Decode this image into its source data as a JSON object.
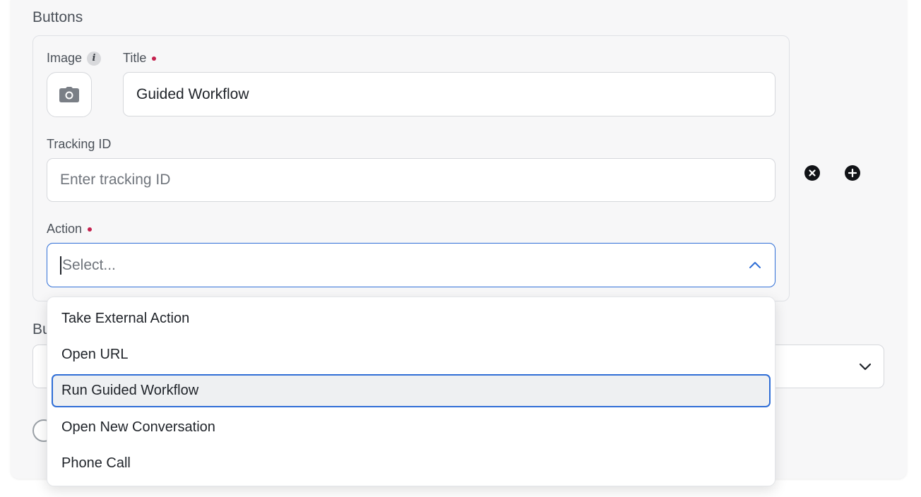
{
  "section_title": "Buttons",
  "button_form": {
    "image_label": "Image",
    "info_glyph": "i",
    "title_label": "Title",
    "title_value": "Guided Workflow",
    "tracking_label": "Tracking ID",
    "tracking_placeholder": "Enter tracking ID",
    "action_label": "Action",
    "action_placeholder": "Select..."
  },
  "row_icons": [
    "close-circle-icon",
    "plus-circle-icon"
  ],
  "background_label_fragment": "Bu",
  "dropdown": {
    "options": [
      "Take External Action",
      "Open URL",
      "Run Guided Workflow",
      "Open New Conversation",
      "Phone Call"
    ],
    "highlighted_option": "Run Guided Workflow"
  },
  "colors": {
    "accent": "#2f6ed6",
    "required": "#c4214e",
    "panel_bg": "#f7f7f8"
  }
}
